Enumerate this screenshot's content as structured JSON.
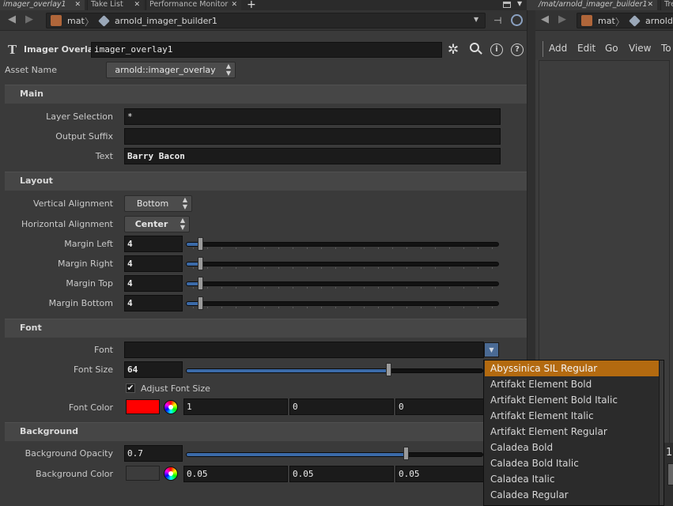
{
  "tabs": [
    {
      "label": "imager_overlay1"
    },
    {
      "label": "Take List"
    },
    {
      "label": "Performance Monitor"
    }
  ],
  "right_tabs": [
    {
      "label": "/mat/arnold_imager_builder1"
    },
    {
      "label": "Tre"
    }
  ],
  "pathbar": {
    "crumb1": "mat",
    "crumb2": "arnold_imager_builder1"
  },
  "right_pathbar": {
    "crumb1": "mat",
    "crumb2": "arnold"
  },
  "right_menu": [
    "Add",
    "Edit",
    "Go",
    "View",
    "To"
  ],
  "header": {
    "node_type": "Imager Overlay",
    "node_name": "imager_overlay1"
  },
  "asset": {
    "label": "Asset Name",
    "value": "arnold::imager_overlay"
  },
  "sections": {
    "main": "Main",
    "layout": "Layout",
    "font": "Font",
    "background": "Background"
  },
  "main": {
    "layer_selection_label": "Layer Selection",
    "layer_selection_value": "*",
    "output_suffix_label": "Output Suffix",
    "output_suffix_value": "",
    "text_label": "Text",
    "text_value": "Barry Bacon"
  },
  "layout": {
    "vertical_alignment_label": "Vertical Alignment",
    "vertical_alignment_value": "Bottom",
    "horizontal_alignment_label": "Horizontal Alignment",
    "horizontal_alignment_value": "Center",
    "margins": [
      {
        "label": "Margin Left",
        "value": "4",
        "fraction": 0.045
      },
      {
        "label": "Margin Right",
        "value": "4",
        "fraction": 0.045
      },
      {
        "label": "Margin Top",
        "value": "4",
        "fraction": 0.045
      },
      {
        "label": "Margin Bottom",
        "value": "4",
        "fraction": 0.045
      }
    ]
  },
  "font": {
    "font_label": "Font",
    "font_value": "",
    "font_size_label": "Font Size",
    "font_size_value": "64",
    "font_size_fraction": 0.68,
    "adjust_label": "Adjust Font Size",
    "adjust_checked": true,
    "color_label": "Font Color",
    "color_swatch": "#ff0000",
    "color_values": [
      "1",
      "0",
      "0"
    ]
  },
  "background": {
    "opacity_label": "Background Opacity",
    "opacity_value": "0.7",
    "opacity_fraction": 0.74,
    "color_label": "Background Color",
    "color_swatch": "#3c3c3c",
    "color_values": [
      "0.05",
      "0.05",
      "0.05"
    ]
  },
  "font_popup": [
    "Abyssinica SIL Regular",
    "Artifakt Element Bold",
    "Artifakt Element Bold Italic",
    "Artifakt Element Italic",
    "Artifakt Element Regular",
    "Caladea Bold",
    "Caladea Bold Italic",
    "Caladea Italic",
    "Caladea Regular"
  ],
  "right_partial_value": "1",
  "colors": {
    "accent": "#3b6aa8",
    "selection": "#b36a10"
  }
}
